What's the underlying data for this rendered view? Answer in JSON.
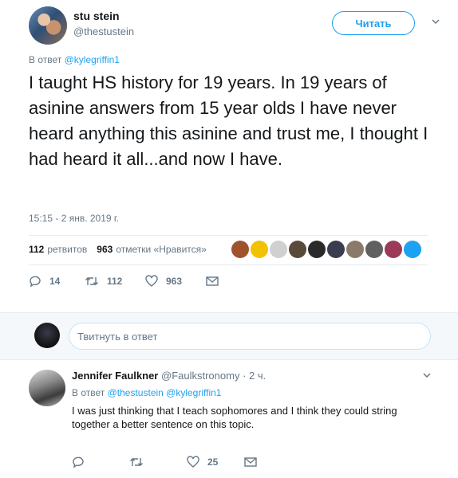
{
  "author": {
    "name": "stu stein",
    "handle": "@thestustein",
    "follow_label": "Читать"
  },
  "tweet": {
    "reply_prefix": "В ответ",
    "reply_to": "@kylegriffin1",
    "text": "I taught HS history for 19 years. In 19 years of asinine answers from 15 year olds I have never heard anything this asinine and trust me, I thought I had heard it all...and now I have.",
    "timestamp": "15:15 - 2 янв. 2019 г.",
    "retweets_count": "112",
    "retweets_label": "ретвитов",
    "likes_count": "963",
    "likes_label": "отметки «Нравится»",
    "likers": [
      "#a0522d",
      "#f2c200",
      "#d0d0d0",
      "#5a4a3a",
      "#2a2a2a",
      "#3c3c50",
      "#8a7a6a",
      "#606060",
      "#9c3a5a",
      "#1da1f2"
    ]
  },
  "actions": {
    "reply_count": "14",
    "retweet_count": "112",
    "like_count": "963"
  },
  "reply_box": {
    "placeholder": "Твитнуть в ответ"
  },
  "reply": {
    "name": "Jennifer Faulkner",
    "handle": "@Faulkstronomy",
    "time": "· 2 ч.",
    "reply_prefix": "В ответ",
    "reply_to": "@thestustein @kylegriffin1",
    "text": "I was just thinking that I teach sophomores and I think they could string together a better sentence on this topic.",
    "reply_count": "",
    "retweet_count": "",
    "like_count": "25"
  }
}
